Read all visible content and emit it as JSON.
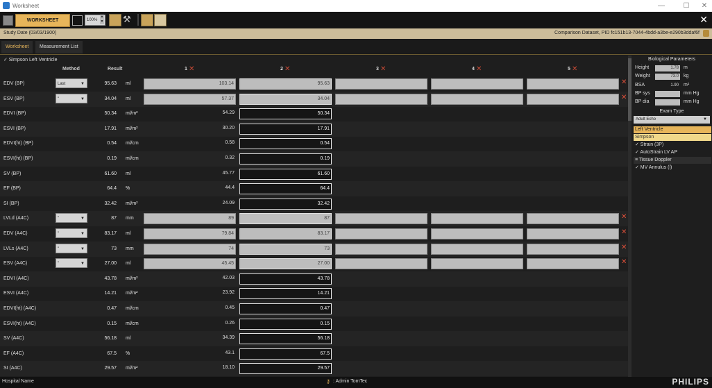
{
  "window": {
    "title": "Worksheet",
    "minimize": "—",
    "maximize": "☐",
    "close": "✕"
  },
  "toolbar": {
    "worksheet_label": "WORKSHEET",
    "zoom": "100%"
  },
  "study": {
    "left": "Study Date (03/03/1900)",
    "right": "Comparison Dataset, PID fc151b13-7044-4bdd-a3be-e290b3ddaf6f"
  },
  "tabs": [
    "Worksheet",
    "Measurement List"
  ],
  "breadcrumb": "✓ Simpson   Left Ventricle",
  "headers": {
    "method": "Method",
    "result": "Result",
    "cols": [
      "1",
      "2",
      "3",
      "4",
      "5"
    ]
  },
  "rows": [
    {
      "label": "EDV (BP)",
      "method": "Last",
      "result": "95.63",
      "unit": "ml",
      "c1": "103.14",
      "c2": "95.63",
      "kind": "grey"
    },
    {
      "label": "ESV (BP)",
      "method": "\"",
      "result": "34.04",
      "unit": "ml",
      "c1": "57.37",
      "c2": "34.04",
      "kind": "grey"
    },
    {
      "label": "EDVI (BP)",
      "method": "",
      "result": "50.34",
      "unit": "ml/m²",
      "c1": "54.29",
      "c2": "50.34",
      "kind": "plain"
    },
    {
      "label": "ESVI (BP)",
      "method": "",
      "result": "17.91",
      "unit": "ml/m²",
      "c1": "30.20",
      "c2": "17.91",
      "kind": "plain"
    },
    {
      "label": "EDVI(ht) (BP)",
      "method": "",
      "result": "0.54",
      "unit": "ml/cm",
      "c1": "0.58",
      "c2": "0.54",
      "kind": "plain"
    },
    {
      "label": "ESVI(ht) (BP)",
      "method": "",
      "result": "0.19",
      "unit": "ml/cm",
      "c1": "0.32",
      "c2": "0.19",
      "kind": "plain"
    },
    {
      "label": "SV (BP)",
      "method": "",
      "result": "61.60",
      "unit": "ml",
      "c1": "45.77",
      "c2": "61.60",
      "kind": "plain"
    },
    {
      "label": "EF (BP)",
      "method": "",
      "result": "64.4",
      "unit": "%",
      "c1": "44.4",
      "c2": "64.4",
      "kind": "plain"
    },
    {
      "label": "SI (BP)",
      "method": "",
      "result": "32.42",
      "unit": "ml/m²",
      "c1": "24.09",
      "c2": "32.42",
      "kind": "plain"
    },
    {
      "label": "LVLd (A4C)",
      "method": "\"",
      "result": "87",
      "unit": "mm",
      "c1": "89",
      "c2": "87",
      "kind": "grey"
    },
    {
      "label": "EDV (A4C)",
      "method": "\"",
      "result": "83.17",
      "unit": "ml",
      "c1": "79.84",
      "c2": "83.17",
      "kind": "grey"
    },
    {
      "label": "LVLs (A4C)",
      "method": "\"",
      "result": "73",
      "unit": "mm",
      "c1": "74",
      "c2": "73",
      "kind": "grey"
    },
    {
      "label": "ESV (A4C)",
      "method": "\"",
      "result": "27.00",
      "unit": "ml",
      "c1": "45.45",
      "c2": "27.00",
      "kind": "grey"
    },
    {
      "label": "EDVI (A4C)",
      "method": "",
      "result": "43.78",
      "unit": "ml/m²",
      "c1": "42.03",
      "c2": "43.78",
      "kind": "plain"
    },
    {
      "label": "ESVI (A4C)",
      "method": "",
      "result": "14.21",
      "unit": "ml/m²",
      "c1": "23.92",
      "c2": "14.21",
      "kind": "plain"
    },
    {
      "label": "EDVI(ht) (A4C)",
      "method": "",
      "result": "0.47",
      "unit": "ml/cm",
      "c1": "0.45",
      "c2": "0.47",
      "kind": "plain"
    },
    {
      "label": "ESVI(ht) (A4C)",
      "method": "",
      "result": "0.15",
      "unit": "ml/cm",
      "c1": "0.26",
      "c2": "0.15",
      "kind": "plain"
    },
    {
      "label": "SV (A4C)",
      "method": "",
      "result": "56.18",
      "unit": "ml",
      "c1": "34.39",
      "c2": "56.18",
      "kind": "plain"
    },
    {
      "label": "EF (A4C)",
      "method": "",
      "result": "67.5",
      "unit": "%",
      "c1": "43.1",
      "c2": "67.5",
      "kind": "plain"
    },
    {
      "label": "SI (A4C)",
      "method": "",
      "result": "29.57",
      "unit": "ml/m²",
      "c1": "18.10",
      "c2": "29.57",
      "kind": "plain"
    }
  ],
  "bio": {
    "title": "Biological Parameters",
    "height": {
      "label": "Height",
      "value": "1.78",
      "unit": "m"
    },
    "weight": {
      "label": "Weight",
      "value": "73.0",
      "unit": "kg"
    },
    "bsa": {
      "label": "BSA",
      "value": "1.90",
      "unit": "m²"
    },
    "bpsys": {
      "label": "BP sys",
      "value": "",
      "unit": "mm Hg"
    },
    "bpdia": {
      "label": "BP dia",
      "value": "",
      "unit": "mm Hg"
    }
  },
  "exam": {
    "title": "Exam Type",
    "selected": "Adult Echo",
    "items": [
      "Left Ventricle",
      "Simpson",
      "✓ Strain (3P)",
      "✓ AutoStrain LV AP",
      "≡ Tissue Doppler",
      "✓ MV Annulus (l)"
    ]
  },
  "status": {
    "hospital": "Hospital Name",
    "user": ": Admin TomTec",
    "logo": "PHILIPS"
  },
  "colors": {
    "accent": "#e7b55a",
    "xmark": "#e0503a"
  }
}
